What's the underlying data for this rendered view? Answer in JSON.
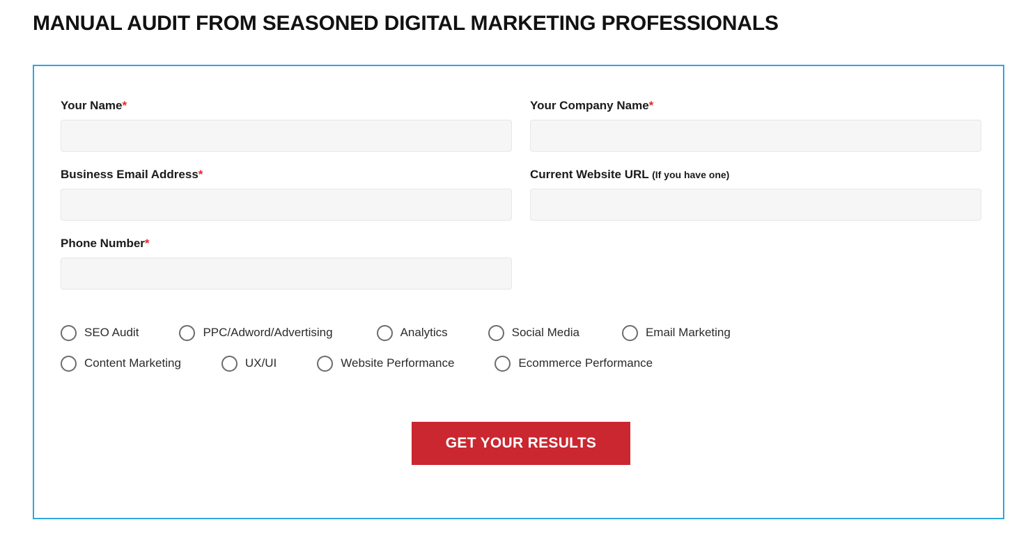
{
  "page": {
    "title": "MANUAL AUDIT FROM SEASONED DIGITAL MARKETING PROFESSIONALS"
  },
  "theme": {
    "panel_border": "#2ca6de",
    "required_star": "#e8262d",
    "submit_bg": "#ca2731",
    "input_bg": "#f6f6f6"
  },
  "form": {
    "fields": [
      {
        "label": "Your Name",
        "required_mark": "*",
        "note": "",
        "value": "",
        "placeholder": ""
      },
      {
        "label": "Your Company Name",
        "required_mark": "*",
        "note": "",
        "value": "",
        "placeholder": ""
      },
      {
        "label": "Business Email Address",
        "required_mark": "*",
        "note": "",
        "value": "",
        "placeholder": ""
      },
      {
        "label": "Current Website URL",
        "required_mark": "",
        "note": "(If you have one)",
        "value": "",
        "placeholder": ""
      },
      {
        "label": "Phone Number",
        "required_mark": "*",
        "note": "",
        "value": "",
        "placeholder": ""
      }
    ],
    "radio_rows": [
      [
        {
          "label": "SEO Audit",
          "selected": false,
          "gap": 0
        },
        {
          "label": "PPC/Adword/Advertising",
          "selected": false,
          "gap": 58
        },
        {
          "label": "Analytics",
          "selected": false,
          "gap": 63
        },
        {
          "label": "Social Media",
          "selected": false,
          "gap": 58
        },
        {
          "label": "Email Marketing",
          "selected": false,
          "gap": 61
        }
      ],
      [
        {
          "label": "Content Marketing",
          "selected": false,
          "gap": 0
        },
        {
          "label": "UX/UI",
          "selected": false,
          "gap": 58
        },
        {
          "label": "Website Performance",
          "selected": false,
          "gap": 58
        },
        {
          "label": "Ecommerce Performance",
          "selected": false,
          "gap": 58
        }
      ]
    ],
    "submit_label": "GET YOUR RESULTS"
  }
}
